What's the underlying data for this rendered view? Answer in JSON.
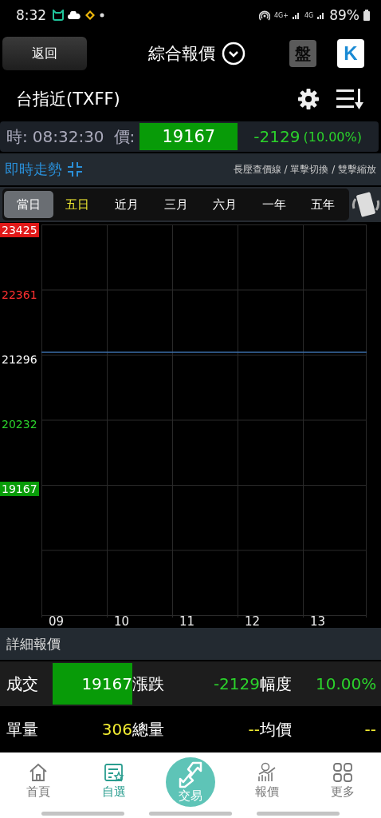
{
  "status_bar": {
    "time": "8:32",
    "battery": "89%",
    "lte": [
      "4G+",
      "4G"
    ]
  },
  "header": {
    "back": "返回",
    "title": "綜合報價",
    "pan": "盤",
    "k": "K"
  },
  "symbol": {
    "name": "台指近(TXFF)"
  },
  "quote": {
    "time_label": "時:",
    "time": "08:32:30",
    "price_label": "價:",
    "price": {
      "text": "19167",
      "color": "#089b08"
    },
    "change": {
      "text": "-2129",
      "color": "#2bd22b"
    },
    "percent": {
      "text": "(10.00%)",
      "color": "#2bd22b"
    }
  },
  "trend": {
    "title": "即時走勢",
    "hint": "長壓查價線 / 單擊切換 / 雙擊縮放"
  },
  "periods": [
    {
      "label": "當日",
      "selected": true,
      "highlighted": false
    },
    {
      "label": "五日",
      "selected": false,
      "highlighted": true
    },
    {
      "label": "近月",
      "selected": false,
      "highlighted": false
    },
    {
      "label": "三月",
      "selected": false,
      "highlighted": false
    },
    {
      "label": "六月",
      "selected": false,
      "highlighted": false
    },
    {
      "label": "一年",
      "selected": false,
      "highlighted": false
    },
    {
      "label": "五年",
      "selected": false,
      "highlighted": false
    }
  ],
  "chart": {
    "y_labels": [
      {
        "text": "23425",
        "kind": "limit-up"
      },
      {
        "text": "22361",
        "kind": "up"
      },
      {
        "text": "21296",
        "kind": "flat"
      },
      {
        "text": "20232",
        "kind": "down"
      },
      {
        "text": "19167",
        "kind": "limit-down"
      }
    ],
    "x_labels": [
      "09",
      "10",
      "11",
      "12",
      "13"
    ]
  },
  "details": {
    "title": "詳細報價",
    "rows": [
      [
        {
          "label": "成交",
          "value": "19167",
          "color": "#089b08",
          "boxed": true
        },
        {
          "label": "漲跌",
          "value": "-2129",
          "color": "#2bd22b"
        },
        {
          "label": "幅度",
          "value": "10.00%",
          "color": "#2bd22b"
        }
      ],
      [
        {
          "label": "單量",
          "value": "306",
          "color": "#f2ec32"
        },
        {
          "label": "總量",
          "value": "--",
          "color": "#f2ec32"
        },
        {
          "label": "均價",
          "value": "--",
          "color": "#f2ec32"
        }
      ]
    ]
  },
  "nav": [
    {
      "label": "首頁",
      "kind": "home",
      "selected": false
    },
    {
      "label": "自選",
      "kind": "watchlist",
      "selected": true
    },
    {
      "label": "交易",
      "kind": "trade",
      "selected": false
    },
    {
      "label": "報價",
      "kind": "quote",
      "selected": false
    },
    {
      "label": "更多",
      "kind": "more",
      "selected": false
    }
  ]
}
